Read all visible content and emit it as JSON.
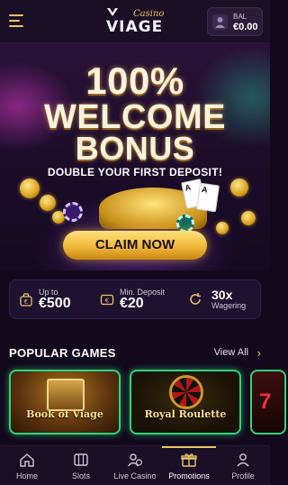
{
  "header": {
    "logo_casino": "Casino",
    "logo_main": "VIAGE",
    "balance_label": "BAL",
    "balance_value": "€0.00"
  },
  "hero": {
    "line1": "100%",
    "line2": "WELCOME",
    "line3": "BONUS",
    "subtitle": "DOUBLE YOUR FIRST DEPOSIT!",
    "cta_label": "CLAIM NOW",
    "card_labels": [
      "A",
      "A"
    ]
  },
  "info": {
    "bonus": {
      "small": "Up to",
      "big": "€500"
    },
    "deposit": {
      "small": "Min. Deposit",
      "big": "€20"
    },
    "wagering": {
      "big": "30x",
      "small": "Wagering"
    }
  },
  "games": {
    "title": "POPULAR GAMES",
    "view_all": "View All",
    "arrow": "›",
    "items": [
      {
        "label": "Book of Viage"
      },
      {
        "label": "Royal Roulette"
      },
      {
        "label": "7"
      }
    ]
  },
  "nav": {
    "items": [
      {
        "label": "Home",
        "icon": "home-icon"
      },
      {
        "label": "Slots",
        "icon": "slots-icon"
      },
      {
        "label": "Live Casino",
        "icon": "live-casino-icon"
      },
      {
        "label": "Promotions",
        "icon": "gift-icon"
      },
      {
        "label": "Profile",
        "icon": "profile-icon"
      }
    ],
    "active": "Promotions"
  },
  "colors": {
    "accent_gold": "#e9c46a",
    "background": "#120a1c",
    "tile_glow": "#2fd27a"
  }
}
